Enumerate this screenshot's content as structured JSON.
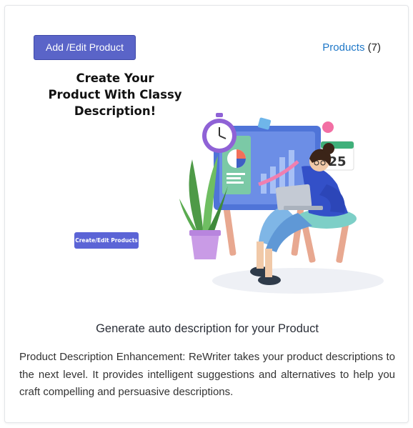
{
  "toolbar": {
    "add_edit_label": "Add /Edit Product",
    "products_label": "Products",
    "products_count": "(7)"
  },
  "hero": {
    "title_line1": "Create Your",
    "title_line2": "Product With Classy",
    "title_line3": "Description!",
    "button_label": "Create/Edit Products",
    "calendar_day": "25"
  },
  "content": {
    "heading": "Generate auto description for your Product",
    "description": "Product Description Enhancement: ReWriter takes your product descriptions to the next level. It provides intelligent suggestions and alternatives to help you craft compelling and persuasive descriptions."
  },
  "colors": {
    "accent": "#5a64c8",
    "link": "#1f78c8"
  }
}
